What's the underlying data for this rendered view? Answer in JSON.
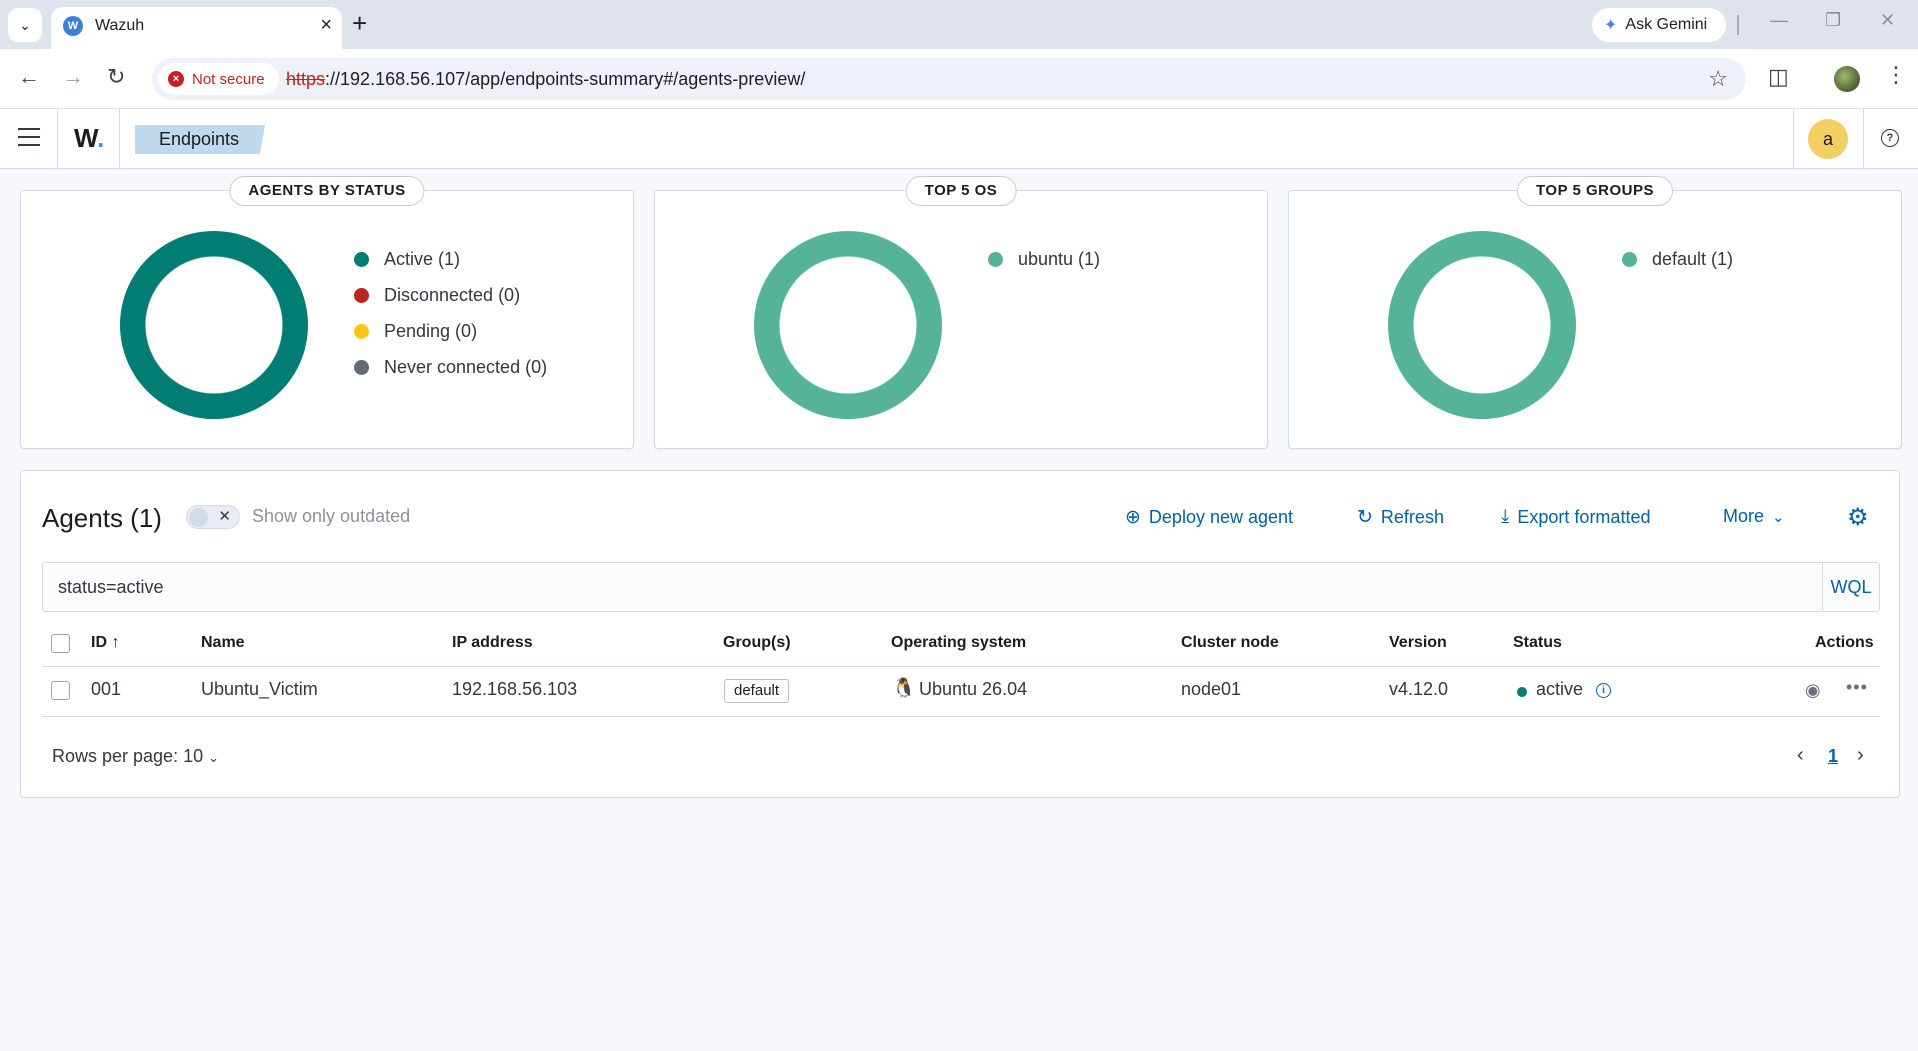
{
  "browser": {
    "tab_title": "Wazuh",
    "tab_favicon_letter": "W",
    "gemini_label": "Ask Gemini",
    "security_label": "Not secure",
    "url_scheme": "https",
    "url_rest": "://192.168.56.107/app/endpoints-summary#/agents-preview/"
  },
  "app": {
    "logo": "W",
    "logo_dot": ".",
    "breadcrumb": "Endpoints",
    "user_initial": "a"
  },
  "panels": {
    "status": {
      "title": "AGENTS BY STATUS",
      "legend": [
        {
          "label": "Active (1)",
          "color": "#017d73"
        },
        {
          "label": "Disconnected (0)",
          "color": "#bd271e"
        },
        {
          "label": "Pending (0)",
          "color": "#fec514"
        },
        {
          "label": "Never connected (0)",
          "color": "#646a77"
        }
      ],
      "ring_color": "#017d73"
    },
    "os": {
      "title": "TOP 5 OS",
      "legend": [
        {
          "label": "ubuntu (1)",
          "color": "#54b399"
        }
      ],
      "ring_color": "#54b399"
    },
    "groups": {
      "title": "TOP 5 GROUPS",
      "legend": [
        {
          "label": "default (1)",
          "color": "#54b399"
        }
      ],
      "ring_color": "#54b399"
    }
  },
  "agents": {
    "title": "Agents (1)",
    "toggle_label": "Show only outdated",
    "actions": {
      "deploy": "Deploy new agent",
      "refresh": "Refresh",
      "export": "Export formatted",
      "more": "More"
    },
    "search_value": "status=active",
    "wql_label": "WQL",
    "columns": {
      "id": "ID",
      "name": "Name",
      "ip": "IP address",
      "groups": "Group(s)",
      "os": "Operating system",
      "node": "Cluster node",
      "version": "Version",
      "status": "Status",
      "actions": "Actions"
    },
    "rows": [
      {
        "id": "001",
        "name": "Ubuntu_Victim",
        "ip": "192.168.56.103",
        "group": "default",
        "os": "Ubuntu 26.04",
        "node": "node01",
        "version": "v4.12.0",
        "status": "active"
      }
    ],
    "rows_per_page": "Rows per page: 10",
    "current_page": "1"
  }
}
